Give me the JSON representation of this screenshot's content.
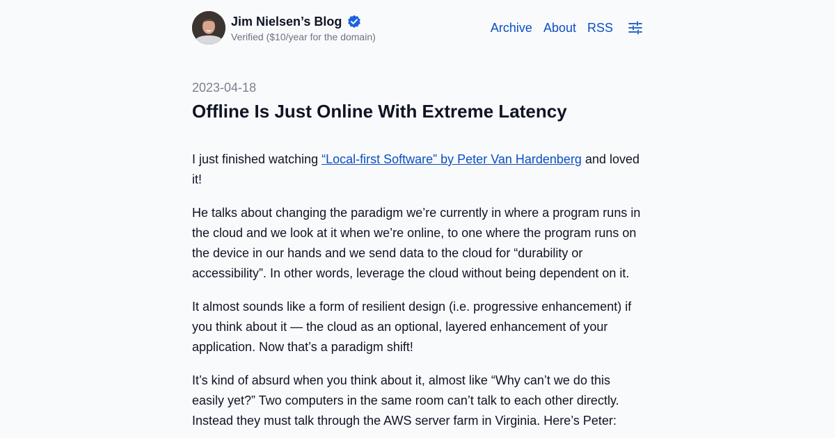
{
  "header": {
    "title": "Jim Nielsen’s Blog",
    "subtitle": "Verified ($10/year for the domain)",
    "nav": {
      "archive": "Archive",
      "about": "About",
      "rss": "RSS"
    },
    "verified_icon": "verified-badge-icon",
    "settings_icon": "sliders-icon",
    "colors": {
      "link": "#0a4fc3",
      "badge": "#1b63e0"
    }
  },
  "post": {
    "date": "2023-04-18",
    "title": "Offline Is Just Online With Extreme Latency",
    "p1": {
      "before": "I just finished watching ",
      "link": "“Local-first Software” by Peter Van Hardenberg",
      "after": " and loved it!"
    },
    "p2": "He talks about changing the paradigm we’re currently in where a program runs in the cloud and we look at it when we’re online, to one where the program runs on the device in our hands and we send data to the cloud for “durability or accessibility”. In other words, leverage the cloud without being dependent on it.",
    "p3": "It almost sounds like a form of resilient design (i.e. progressive enhancement) if you think about it — the cloud as an optional, layered enhancement of your application. Now that’s a paradigm shift!",
    "p4": "It’s kind of absurd when you think about it, almost like “Why can’t we do this easily yet?” Two computers in the same room can’t talk to each other directly. Instead they must talk through the AWS server farm in Virginia. Here’s Peter:"
  }
}
